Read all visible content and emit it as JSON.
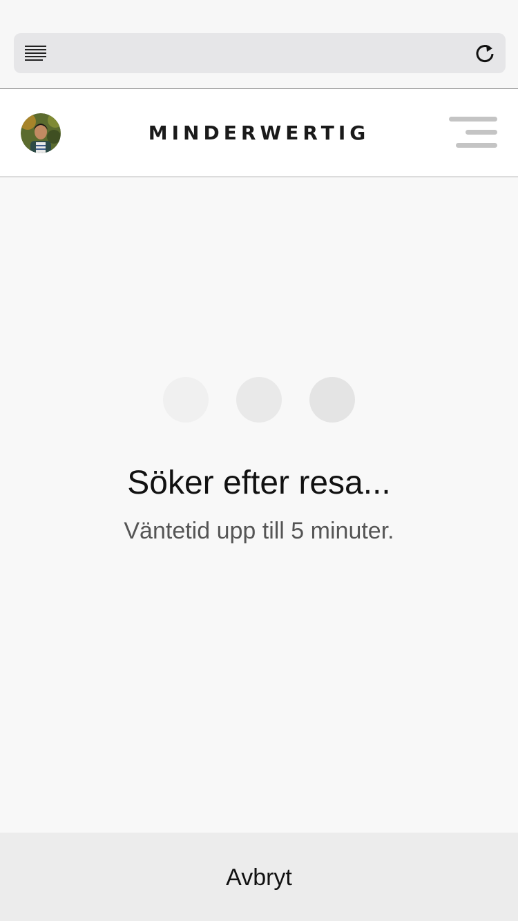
{
  "header": {
    "brand": "MINDERWERTIG"
  },
  "status": {
    "title": "Söker efter resa...",
    "subtitle": "Väntetid upp till 5 minuter."
  },
  "actions": {
    "cancel_label": "Avbryt"
  },
  "icons": {
    "reader": "reader-mode-icon",
    "reload": "reload-icon",
    "menu": "hamburger-menu-icon",
    "avatar": "user-avatar"
  },
  "colors": {
    "dot_1": "#f0f0f0",
    "dot_2": "#e9e9e9",
    "dot_3": "#e4e4e4"
  }
}
